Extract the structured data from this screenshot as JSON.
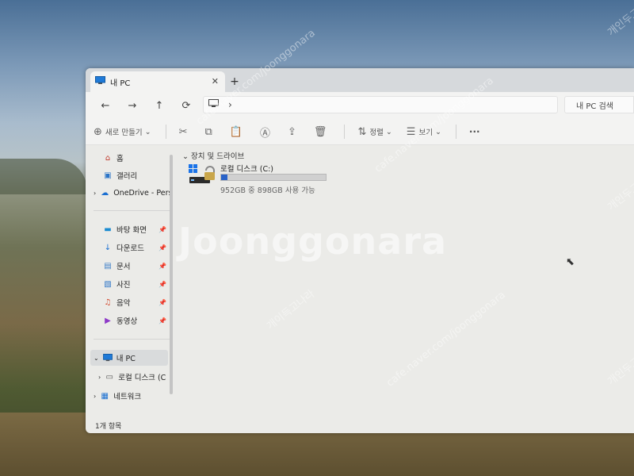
{
  "window": {
    "tab_title": "내 PC",
    "new_tab": "+"
  },
  "address": {
    "path_chevron": "›",
    "search_placeholder": "내 PC 검색"
  },
  "commands": {
    "new_label": "새로 만들기",
    "sort_label": "정렬",
    "view_label": "보기",
    "more": "···"
  },
  "sidebar": {
    "home": "홈",
    "gallery": "갤러리",
    "onedrive": "OneDrive - Pers",
    "desktop": "바탕 화면",
    "downloads": "다운로드",
    "documents": "문서",
    "pictures": "사진",
    "music": "음악",
    "videos": "동영상",
    "this_pc": "내 PC",
    "local_disk": "로컬 디스크 (C",
    "network": "네트워크"
  },
  "content": {
    "group_header": "장치 및 드라이브",
    "drive": {
      "name": "로컬 디스크 (C:)",
      "free_text": "952GB 중 898GB 사용 가능",
      "used_fraction": 0.057
    }
  },
  "status": {
    "items_count": "1개 항목"
  },
  "watermarks": {
    "brand": "Joonggonara",
    "url": "cafe.naver.com/joonggonara",
    "korean": "개인두고나라",
    "korean2": "개이득고나라"
  },
  "colors": {
    "drive_fill": "#2a63c8",
    "selected_bg": "#d9dbdc"
  }
}
